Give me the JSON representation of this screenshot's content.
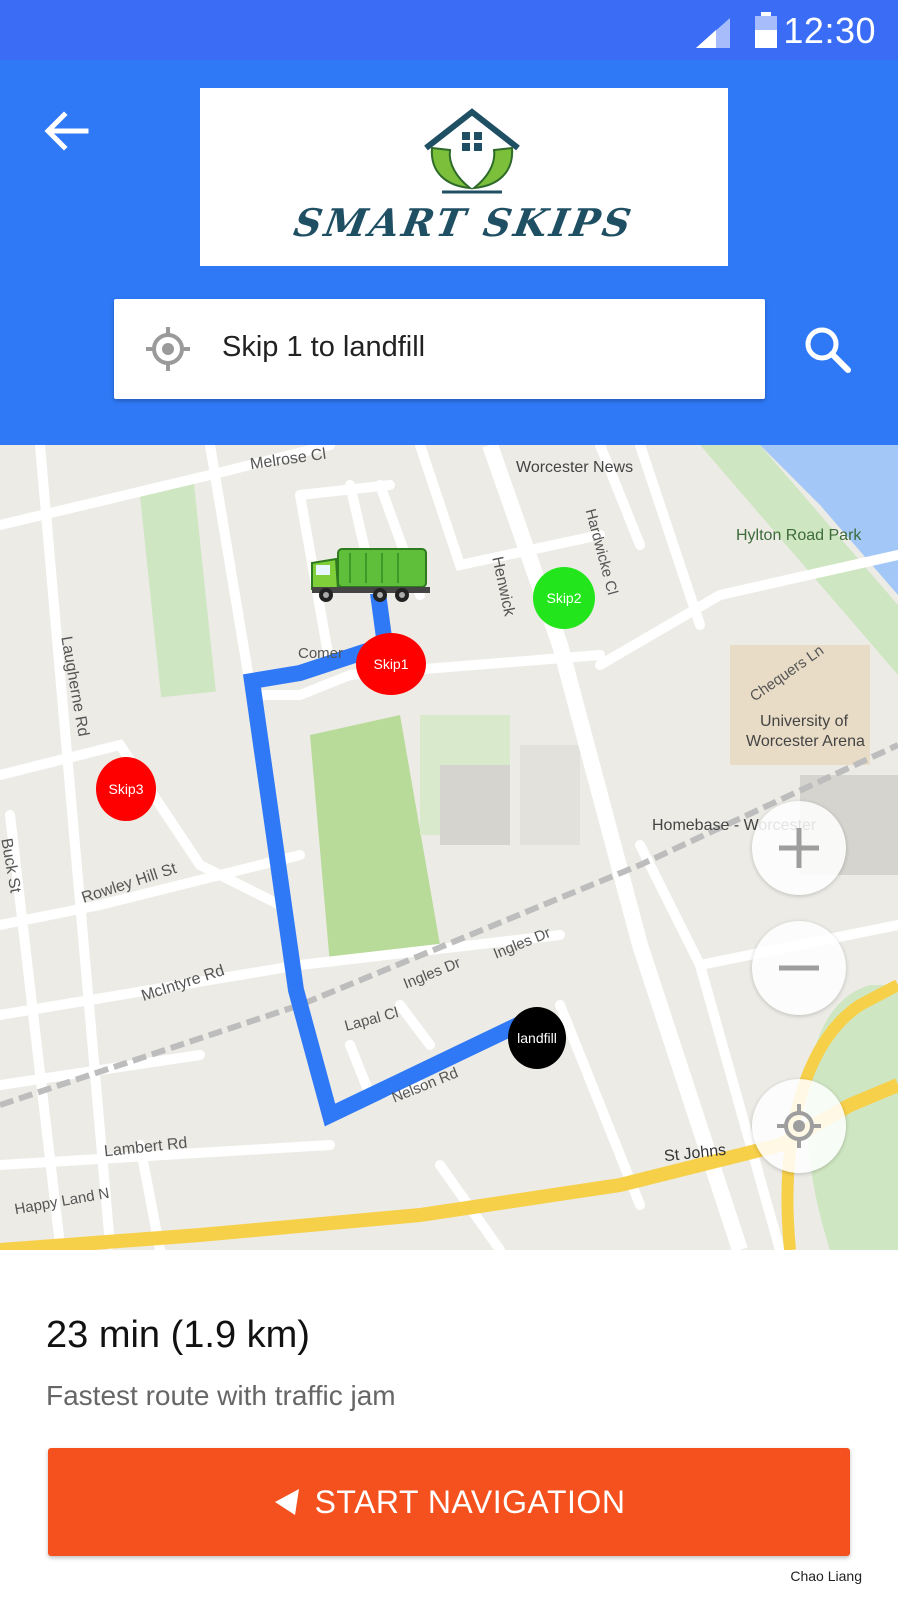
{
  "status_bar": {
    "time": "12:30",
    "icons": [
      "signal-icon",
      "battery-icon"
    ]
  },
  "app_bar": {
    "back_icon": "arrow-back-icon",
    "logo_text": "SMART SKIPS",
    "search": {
      "value": "Skip 1 to landfill",
      "icon": "location-target-icon"
    },
    "search_button_icon": "search-icon"
  },
  "map": {
    "street_labels": {
      "melrose": "Melrose Cl",
      "worcester_news": "Worcester News",
      "hylton_park": "Hylton Road Park",
      "henwick": "Henwick",
      "hardwicke": "Hardwicke Cl",
      "comer": "Comer",
      "chequers": "Chequers Ln",
      "university": "University of",
      "arena": "Worcester Arena",
      "laugherne": "Laugherne Rd",
      "homebase": "Homebase - Worcester",
      "buck": "Buck St",
      "rowley": "Rowley Hill St",
      "mcintyre": "McIntyre Rd",
      "ingles1": "Ingles Dr",
      "ingles2": "Ingles Dr",
      "lapal": "Lapal Cl",
      "nelson": "Nelson Rd",
      "lambert": "Lambert Rd",
      "st_johns": "St Johns",
      "happy_land": "Happy Land N"
    },
    "markers": {
      "skip1": "Skip1",
      "skip2": "Skip2",
      "skip3": "Skip3",
      "landfill": "landfill"
    },
    "colors": {
      "route": "#2f79f6",
      "skip_full": "#ff0000",
      "skip_empty": "#22e61b",
      "landfill": "#000000"
    },
    "controls": {
      "zoom_in": "zoom-in-icon",
      "zoom_out": "zoom-out-icon",
      "my_location": "my-location-icon"
    }
  },
  "route_sheet": {
    "eta": "23 min (1.9 km)",
    "description": "Fastest route with traffic jam",
    "button_label": "START NAVIGATION",
    "button_icon": "navigation-arrow-icon",
    "button_color": "#f4511e",
    "credit": "Chao Liang"
  }
}
